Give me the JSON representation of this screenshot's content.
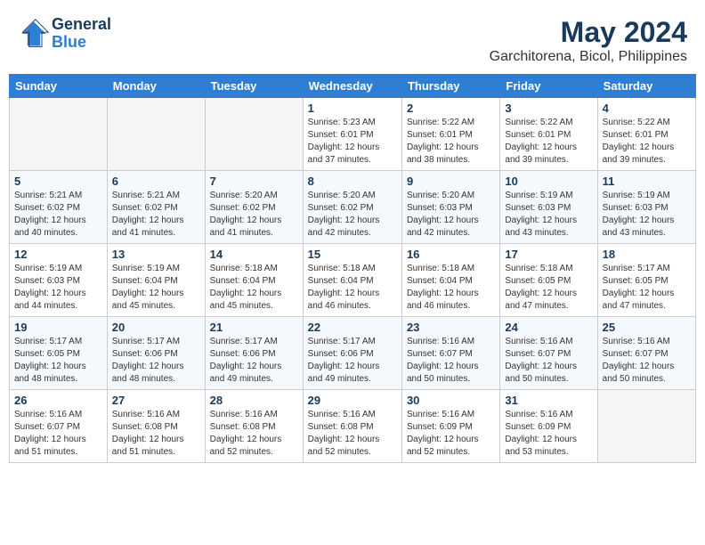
{
  "header": {
    "logo_line1": "General",
    "logo_line2": "Blue",
    "title": "May 2024",
    "subtitle": "Garchitorena, Bicol, Philippines"
  },
  "weekdays": [
    "Sunday",
    "Monday",
    "Tuesday",
    "Wednesday",
    "Thursday",
    "Friday",
    "Saturday"
  ],
  "weeks": [
    [
      {
        "day": "",
        "info": ""
      },
      {
        "day": "",
        "info": ""
      },
      {
        "day": "",
        "info": ""
      },
      {
        "day": "1",
        "info": "Sunrise: 5:23 AM\nSunset: 6:01 PM\nDaylight: 12 hours\nand 37 minutes."
      },
      {
        "day": "2",
        "info": "Sunrise: 5:22 AM\nSunset: 6:01 PM\nDaylight: 12 hours\nand 38 minutes."
      },
      {
        "day": "3",
        "info": "Sunrise: 5:22 AM\nSunset: 6:01 PM\nDaylight: 12 hours\nand 39 minutes."
      },
      {
        "day": "4",
        "info": "Sunrise: 5:22 AM\nSunset: 6:01 PM\nDaylight: 12 hours\nand 39 minutes."
      }
    ],
    [
      {
        "day": "5",
        "info": "Sunrise: 5:21 AM\nSunset: 6:02 PM\nDaylight: 12 hours\nand 40 minutes."
      },
      {
        "day": "6",
        "info": "Sunrise: 5:21 AM\nSunset: 6:02 PM\nDaylight: 12 hours\nand 41 minutes."
      },
      {
        "day": "7",
        "info": "Sunrise: 5:20 AM\nSunset: 6:02 PM\nDaylight: 12 hours\nand 41 minutes."
      },
      {
        "day": "8",
        "info": "Sunrise: 5:20 AM\nSunset: 6:02 PM\nDaylight: 12 hours\nand 42 minutes."
      },
      {
        "day": "9",
        "info": "Sunrise: 5:20 AM\nSunset: 6:03 PM\nDaylight: 12 hours\nand 42 minutes."
      },
      {
        "day": "10",
        "info": "Sunrise: 5:19 AM\nSunset: 6:03 PM\nDaylight: 12 hours\nand 43 minutes."
      },
      {
        "day": "11",
        "info": "Sunrise: 5:19 AM\nSunset: 6:03 PM\nDaylight: 12 hours\nand 43 minutes."
      }
    ],
    [
      {
        "day": "12",
        "info": "Sunrise: 5:19 AM\nSunset: 6:03 PM\nDaylight: 12 hours\nand 44 minutes."
      },
      {
        "day": "13",
        "info": "Sunrise: 5:19 AM\nSunset: 6:04 PM\nDaylight: 12 hours\nand 45 minutes."
      },
      {
        "day": "14",
        "info": "Sunrise: 5:18 AM\nSunset: 6:04 PM\nDaylight: 12 hours\nand 45 minutes."
      },
      {
        "day": "15",
        "info": "Sunrise: 5:18 AM\nSunset: 6:04 PM\nDaylight: 12 hours\nand 46 minutes."
      },
      {
        "day": "16",
        "info": "Sunrise: 5:18 AM\nSunset: 6:04 PM\nDaylight: 12 hours\nand 46 minutes."
      },
      {
        "day": "17",
        "info": "Sunrise: 5:18 AM\nSunset: 6:05 PM\nDaylight: 12 hours\nand 47 minutes."
      },
      {
        "day": "18",
        "info": "Sunrise: 5:17 AM\nSunset: 6:05 PM\nDaylight: 12 hours\nand 47 minutes."
      }
    ],
    [
      {
        "day": "19",
        "info": "Sunrise: 5:17 AM\nSunset: 6:05 PM\nDaylight: 12 hours\nand 48 minutes."
      },
      {
        "day": "20",
        "info": "Sunrise: 5:17 AM\nSunset: 6:06 PM\nDaylight: 12 hours\nand 48 minutes."
      },
      {
        "day": "21",
        "info": "Sunrise: 5:17 AM\nSunset: 6:06 PM\nDaylight: 12 hours\nand 49 minutes."
      },
      {
        "day": "22",
        "info": "Sunrise: 5:17 AM\nSunset: 6:06 PM\nDaylight: 12 hours\nand 49 minutes."
      },
      {
        "day": "23",
        "info": "Sunrise: 5:16 AM\nSunset: 6:07 PM\nDaylight: 12 hours\nand 50 minutes."
      },
      {
        "day": "24",
        "info": "Sunrise: 5:16 AM\nSunset: 6:07 PM\nDaylight: 12 hours\nand 50 minutes."
      },
      {
        "day": "25",
        "info": "Sunrise: 5:16 AM\nSunset: 6:07 PM\nDaylight: 12 hours\nand 50 minutes."
      }
    ],
    [
      {
        "day": "26",
        "info": "Sunrise: 5:16 AM\nSunset: 6:07 PM\nDaylight: 12 hours\nand 51 minutes."
      },
      {
        "day": "27",
        "info": "Sunrise: 5:16 AM\nSunset: 6:08 PM\nDaylight: 12 hours\nand 51 minutes."
      },
      {
        "day": "28",
        "info": "Sunrise: 5:16 AM\nSunset: 6:08 PM\nDaylight: 12 hours\nand 52 minutes."
      },
      {
        "day": "29",
        "info": "Sunrise: 5:16 AM\nSunset: 6:08 PM\nDaylight: 12 hours\nand 52 minutes."
      },
      {
        "day": "30",
        "info": "Sunrise: 5:16 AM\nSunset: 6:09 PM\nDaylight: 12 hours\nand 52 minutes."
      },
      {
        "day": "31",
        "info": "Sunrise: 5:16 AM\nSunset: 6:09 PM\nDaylight: 12 hours\nand 53 minutes."
      },
      {
        "day": "",
        "info": ""
      }
    ]
  ]
}
